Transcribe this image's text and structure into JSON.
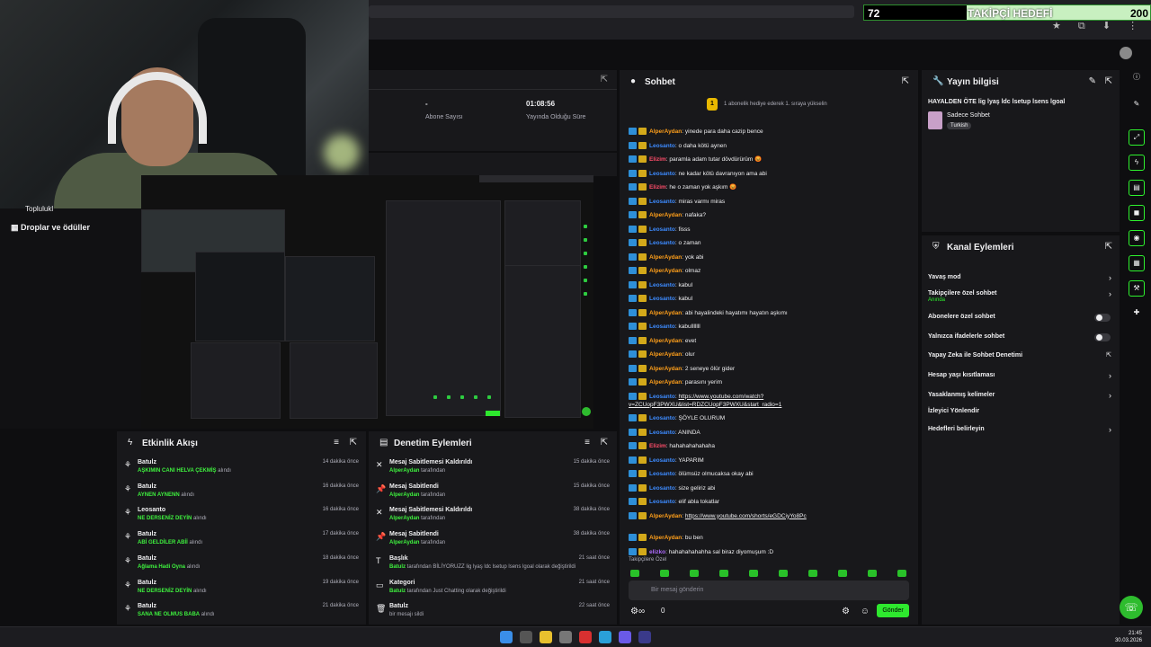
{
  "goal": {
    "current": "72",
    "title": "TAKİPÇİ HEDEFİ",
    "target": "200"
  },
  "stats": {
    "abone_val": "-",
    "abone_label": "Abone Sayısı",
    "time_val": "01:08:56",
    "time_label": "Yayında Olduğu Süre"
  },
  "leftnav": {
    "cut_label": "Toplulukl",
    "droplar": "Droplar ve ödüller"
  },
  "etkinlik": {
    "title": "Etkinlik Akışı",
    "items": [
      {
        "name": "Batulz",
        "reward": "AŞKIMIN CANI HELVA ÇEKMİŞ",
        "suffix": "alındı",
        "time": "14 dakika önce"
      },
      {
        "name": "Batulz",
        "reward": "AYNEN AYNENN",
        "suffix": "alındı",
        "time": "16 dakika önce"
      },
      {
        "name": "Leosanto",
        "reward": "NE DERSENİZ DEYİN",
        "suffix": "alındı",
        "time": "16 dakika önce"
      },
      {
        "name": "Batulz",
        "reward": "ABİ GELDİLER ABİİ",
        "suffix": "alındı",
        "time": "17 dakika önce"
      },
      {
        "name": "Batulz",
        "reward": "Ağlama Hadi Oyna",
        "suffix": "alındı",
        "time": "18 dakika önce"
      },
      {
        "name": "Batulz",
        "reward": "NE DERSENİZ DEYİN",
        "suffix": "alındı",
        "time": "19 dakika önce"
      },
      {
        "name": "Batulz",
        "reward": "SANA NE OLMUS BABA",
        "suffix": "alındı",
        "time": "21 dakika önce"
      }
    ]
  },
  "denetim": {
    "title": "Denetim Eylemleri",
    "items": [
      {
        "name": "Mesaj Sabitlemesi Kaldırıldı",
        "actor": "AlperAydan",
        "rest": "tarafından",
        "time": "15 dakika önce"
      },
      {
        "name": "Mesaj Sabitlendi",
        "actor": "AlperAydan",
        "rest": "tarafından",
        "time": "15 dakika önce"
      },
      {
        "name": "Mesaj Sabitlemesi Kaldırıldı",
        "actor": "AlperAydan",
        "rest": "tarafından",
        "time": "38 dakika önce"
      },
      {
        "name": "Mesaj Sabitlendi",
        "actor": "AlperAydan",
        "rest": "tarafından",
        "time": "38 dakika önce"
      },
      {
        "name": "Başlık",
        "actor": "Batulz",
        "rest": "tarafından BİLİYORUZZ lig lyaş ldc lsetup lsens lgoal olarak değiştirildi",
        "time": "21 saat önce"
      },
      {
        "name": "Kategori",
        "actor": "Batulz",
        "rest": "tarafından Just Chatting olarak değiştirildi",
        "time": "21 saat önce"
      },
      {
        "name": "Batulz",
        "actor": "",
        "rest": "bir mesajı sildi",
        "time": "22 saat önce"
      }
    ]
  },
  "chat": {
    "title": "Sohbet",
    "banner": "1 abonelik hediye ederek 1. sıraya yükselin",
    "badge": "1",
    "messages": [
      {
        "user": "AlperAydan",
        "color": "#ff9f1a",
        "text": "yinede para daha cazip bence"
      },
      {
        "user": "Leosanto",
        "color": "#3d8bff",
        "text": "o daha kötü aynen"
      },
      {
        "user": "Elizim",
        "color": "#ff4d6a",
        "text": "paramla adam tutar dövdürürüm 😡"
      },
      {
        "user": "Leosanto",
        "color": "#3d8bff",
        "text": "ne kadar kötü davranıyon ama abi"
      },
      {
        "user": "Elizim",
        "color": "#ff4d6a",
        "text": "he o zaman yok aşkım 😡"
      },
      {
        "user": "Leosanto",
        "color": "#3d8bff",
        "text": "miras varmı miras"
      },
      {
        "user": "AlperAydan",
        "color": "#ff9f1a",
        "text": "nafaka?"
      },
      {
        "user": "Leosanto",
        "color": "#3d8bff",
        "text": "fisss"
      },
      {
        "user": "Leosanto",
        "color": "#3d8bff",
        "text": "o zaman"
      },
      {
        "user": "AlperAydan",
        "color": "#ff9f1a",
        "text": "yok abi"
      },
      {
        "user": "AlperAydan",
        "color": "#ff9f1a",
        "text": "olmaz"
      },
      {
        "user": "Leosanto",
        "color": "#3d8bff",
        "text": "kabul"
      },
      {
        "user": "Leosanto",
        "color": "#3d8bff",
        "text": "kabul"
      },
      {
        "user": "AlperAydan",
        "color": "#ff9f1a",
        "text": "abi hayalindeki hayatımı hayatın aşkımı"
      },
      {
        "user": "Leosanto",
        "color": "#3d8bff",
        "text": "kabulllllll"
      },
      {
        "user": "AlperAydan",
        "color": "#ff9f1a",
        "text": "evet"
      },
      {
        "user": "AlperAydan",
        "color": "#ff9f1a",
        "text": "olur"
      },
      {
        "user": "AlperAydan",
        "color": "#ff9f1a",
        "text": "2 seneye ölür gider"
      },
      {
        "user": "AlperAydan",
        "color": "#ff9f1a",
        "text": "parasını yerim"
      },
      {
        "user": "Leosanto",
        "color": "#3d8bff",
        "text": "https://www.youtube.com/watch?v=ZCUopF3PWXU&list=RDZCUopF3PWXU&start_radio=1",
        "link": true
      },
      {
        "user": "Leosanto",
        "color": "#3d8bff",
        "text": "ŞÖYLE OLURUM"
      },
      {
        "user": "Leosanto",
        "color": "#3d8bff",
        "text": "ANINDA"
      },
      {
        "user": "Elizim",
        "color": "#ff4d6a",
        "text": "hahahahahahaha"
      },
      {
        "user": "Leosanto",
        "color": "#3d8bff",
        "text": "YAPARIM"
      },
      {
        "user": "Leosanto",
        "color": "#3d8bff",
        "text": "ölümsüz olmucaksa okay abi"
      },
      {
        "user": "Leosanto",
        "color": "#3d8bff",
        "text": "size geliriz abi"
      },
      {
        "user": "Leosanto",
        "color": "#3d8bff",
        "text": "elif abla tokatlar"
      },
      {
        "user": "AlperAydan",
        "color": "#ff9f1a",
        "text": "https://www.youtube.com/shorts/eGDCiyYo8Pc",
        "link": true
      },
      {
        "user": "AlperAydan",
        "color": "#ff9f1a",
        "text": "bu ben"
      },
      {
        "user": "elizko",
        "color": "#b06cff",
        "text": "hahahahahahha sal biraz diyomuşum :D"
      }
    ],
    "footer_label": "Takipçilere Özel",
    "input_placeholder": "Bir mesaj gönderin",
    "points": "0",
    "send_label": "Gönder"
  },
  "yayin": {
    "title": "Yayın bilgisi",
    "stream_title": "HAYALDEN ÖTE lig lyaş ldc lsetup lsens lgoal",
    "category": "Sadece Sohbet",
    "tag": "Turkish"
  },
  "kanal": {
    "title": "Kanal Eylemleri",
    "items": [
      {
        "label": "Yavaş mod",
        "sub": "",
        "control": "chevron"
      },
      {
        "label": "Takipçilere özel sohbet",
        "sub": "Anında",
        "control": "chevron"
      },
      {
        "label": "Abonelere özel sohbet",
        "sub": "",
        "control": "toggle"
      },
      {
        "label": "Yalnızca ifadelerle sohbet",
        "sub": "",
        "control": "toggle"
      },
      {
        "label": "Yapay Zeka ile Sohbet Denetimi",
        "sub": "",
        "control": "external"
      },
      {
        "label": "Hesap yaşı kısıtlaması",
        "sub": "",
        "control": "chevron"
      },
      {
        "label": "Yasaklanmış kelimeler",
        "sub": "",
        "control": "chevron"
      },
      {
        "label": "İzleyici Yönlendir",
        "sub": "",
        "control": "none"
      },
      {
        "label": "Hedefleri belirleyin",
        "sub": "",
        "control": "chevron"
      }
    ]
  },
  "taskbar": {
    "time": "21:45",
    "date": "30.03.2026"
  },
  "colors": {
    "accent": "#2ef22e",
    "panel": "#18181b",
    "bg": "#0e0e10"
  }
}
